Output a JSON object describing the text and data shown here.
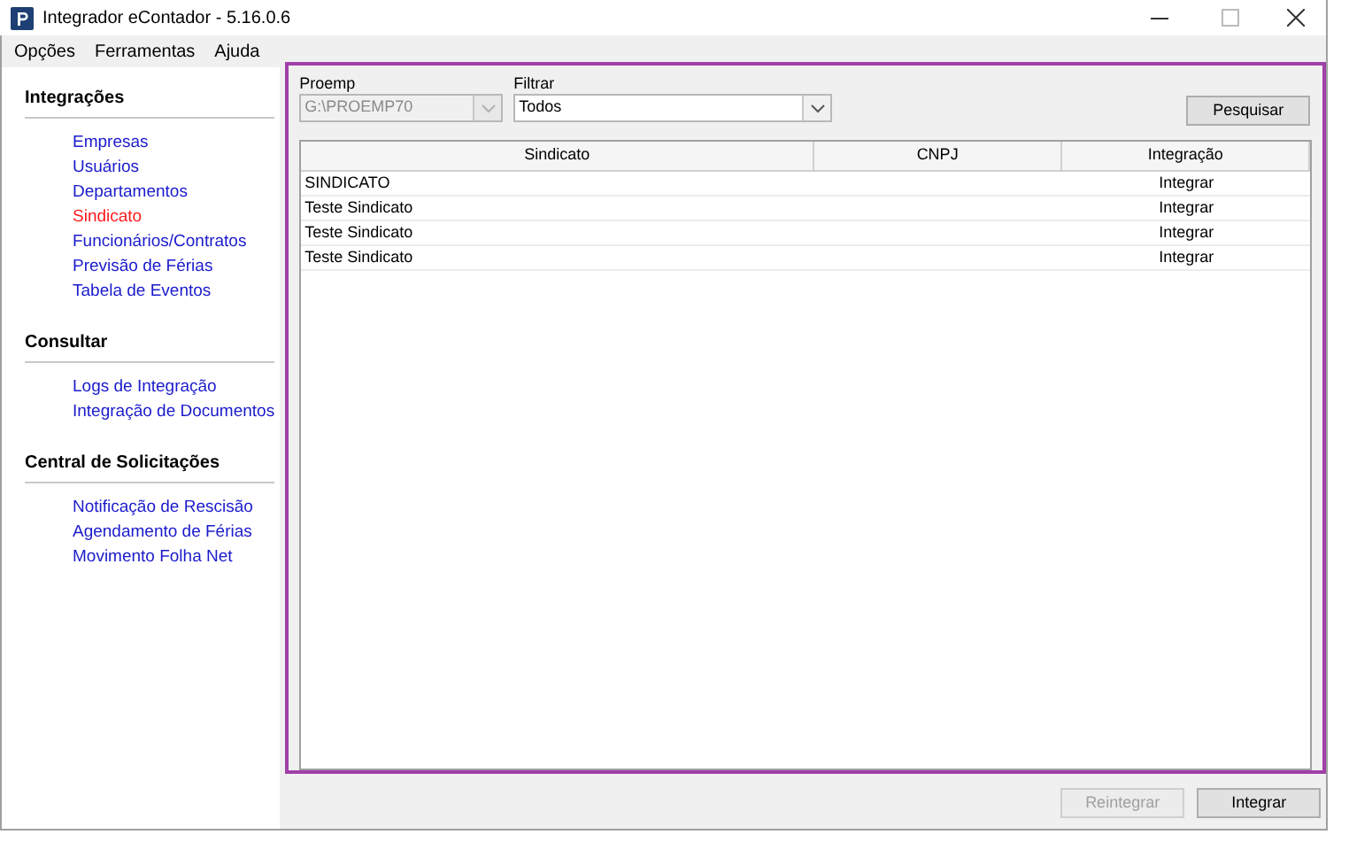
{
  "window": {
    "title": "Integrador eContador - 5.16.0.6"
  },
  "menu": [
    "Opções",
    "Ferramentas",
    "Ajuda"
  ],
  "sidebar": [
    {
      "title": "Integrações",
      "items": [
        {
          "label": "Empresas",
          "selected": false
        },
        {
          "label": "Usuários",
          "selected": false
        },
        {
          "label": "Departamentos",
          "selected": false
        },
        {
          "label": "Sindicato",
          "selected": true
        },
        {
          "label": "Funcionários/Contratos",
          "selected": false
        },
        {
          "label": "Previsão de Férias",
          "selected": false
        },
        {
          "label": "Tabela de Eventos",
          "selected": false
        }
      ]
    },
    {
      "title": "Consultar",
      "items": [
        {
          "label": "Logs de Integração",
          "selected": false
        },
        {
          "label": "Integração de Documentos",
          "selected": false
        }
      ]
    },
    {
      "title": "Central de Solicitações",
      "items": [
        {
          "label": "Notificação de Rescisão",
          "selected": false
        },
        {
          "label": "Agendamento de Férias",
          "selected": false
        },
        {
          "label": "Movimento Folha Net",
          "selected": false
        }
      ]
    }
  ],
  "filters": [
    {
      "label": "Proemp",
      "value": "G:\\PROEMP70",
      "disabled": true
    },
    {
      "label": "Filtrar",
      "value": "Todos",
      "disabled": false
    }
  ],
  "search_button": "Pesquisar",
  "table": {
    "columns": [
      "Sindicato",
      "CNPJ",
      "Integração"
    ],
    "rows": [
      [
        "SINDICATO",
        "",
        "Integrar"
      ],
      [
        "Teste Sindicato",
        "",
        "Integrar"
      ],
      [
        "Teste Sindicato",
        "",
        "Integrar"
      ],
      [
        "Teste Sindicato",
        "",
        "Integrar"
      ]
    ]
  },
  "buttons": [
    {
      "label": "Reintegrar",
      "disabled": true
    },
    {
      "label": "Integrar",
      "disabled": false
    }
  ]
}
